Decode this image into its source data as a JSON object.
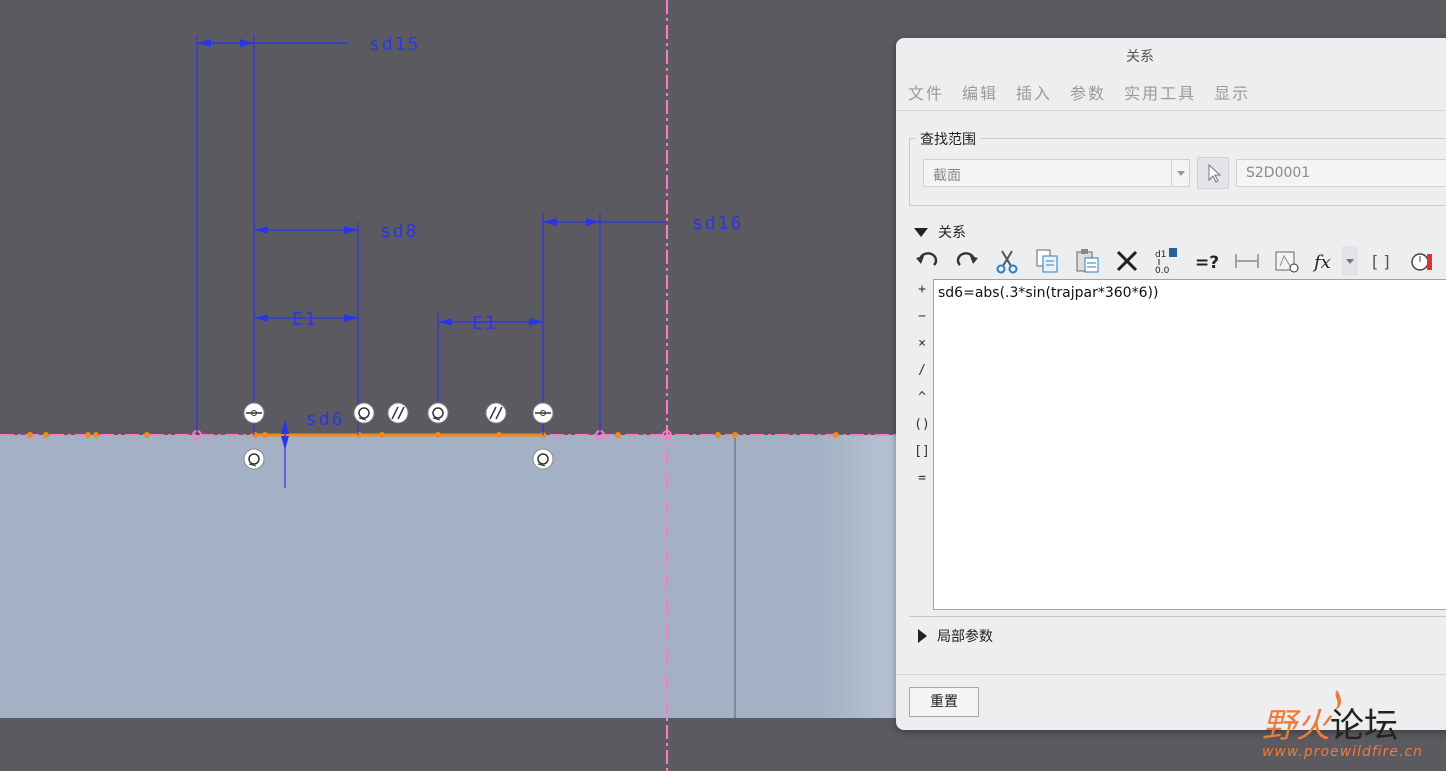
{
  "sketch": {
    "dimensions": {
      "sd15": "sd15",
      "sd8": "sd8",
      "sd16": "sd16",
      "e1_left": "E1",
      "e1_right": "E1",
      "sd6": "sd6"
    }
  },
  "dialog": {
    "title": "关系",
    "menu": [
      "文件",
      "编辑",
      "插入",
      "参数",
      "实用工具",
      "显示"
    ],
    "find_scope": {
      "legend": "查找范围",
      "scope_value": "截面",
      "entity_value": "S2D0001"
    },
    "relations_label": "关系",
    "toolbar_icons": [
      "undo-icon",
      "redo-icon",
      "cut-icon",
      "copy-icon",
      "paste-icon",
      "delete-icon",
      "switch-dimensions-icon",
      "evaluate-icon",
      "show-dimension-icon",
      "sort-relations-icon",
      "insert-function-icon",
      "function-dropdown-icon",
      "insert-brackets-icon",
      "verify-relations-icon"
    ],
    "operators": [
      "+",
      "−",
      "×",
      "/",
      "^",
      "()",
      "[]",
      "="
    ],
    "relation_text": "sd6=abs(.3*sin(trajpar*360*6))",
    "local_params_label": "局部参数",
    "reset_label": "重置"
  },
  "watermark": {
    "brand_a": "野火",
    "brand_b": "论坛",
    "url": "www.proewildfire.cn"
  },
  "colors": {
    "canvas": "#5b5a60",
    "solid": "#a4b1c4",
    "dimension": "#2a35e6",
    "centerline": "#ff79c6",
    "sketch_edge": "#f08a1a"
  }
}
